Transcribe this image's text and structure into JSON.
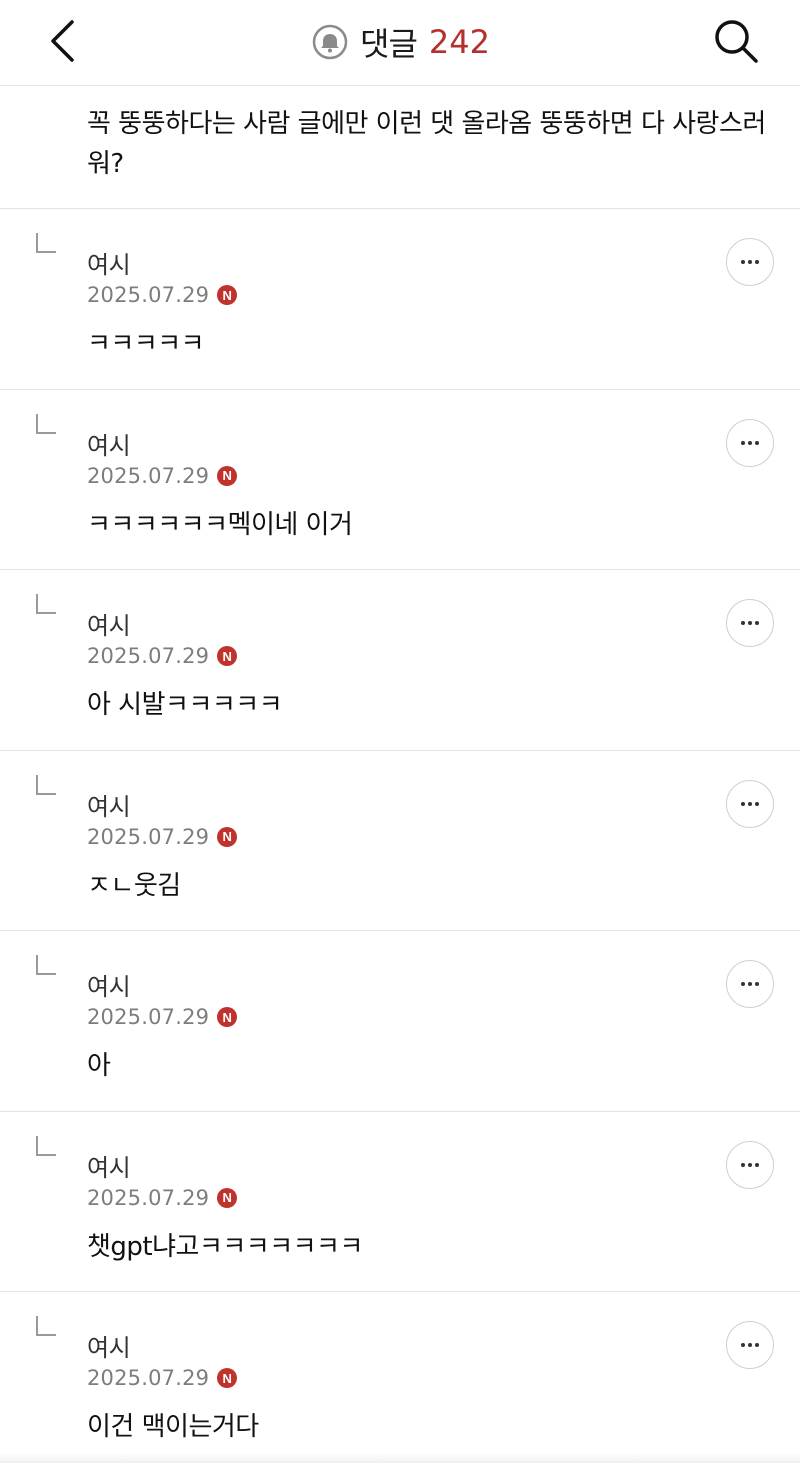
{
  "header": {
    "title": "댓글",
    "count": "242",
    "back_icon": "chevron-left-icon",
    "bell_icon": "bell-icon",
    "search_icon": "search-icon",
    "accent_color": "#b3302c"
  },
  "post": {
    "text": "꼭 뚱뚱하다는 사람 글에만 이런 댓 올라옴 뚱뚱하면 다 사랑스러워?"
  },
  "comments": [
    {
      "author": "여시",
      "date": "2025.07.29",
      "badge": "N",
      "text": "ㅋㅋㅋㅋㅋ"
    },
    {
      "author": "여시",
      "date": "2025.07.29",
      "badge": "N",
      "text": "ㅋㅋㅋㅋㅋㅋ멕이네 이거"
    },
    {
      "author": "여시",
      "date": "2025.07.29",
      "badge": "N",
      "text": "아 시발ㅋㅋㅋㅋㅋ"
    },
    {
      "author": "여시",
      "date": "2025.07.29",
      "badge": "N",
      "text": "ㅈㄴ웃김"
    },
    {
      "author": "여시",
      "date": "2025.07.29",
      "badge": "N",
      "text": "아"
    },
    {
      "author": "여시",
      "date": "2025.07.29",
      "badge": "N",
      "text": "챗gpt냐고ㅋㅋㅋㅋㅋㅋㅋ"
    },
    {
      "author": "여시",
      "date": "2025.07.29",
      "badge": "N",
      "text": "이건 맥이는거다"
    }
  ]
}
